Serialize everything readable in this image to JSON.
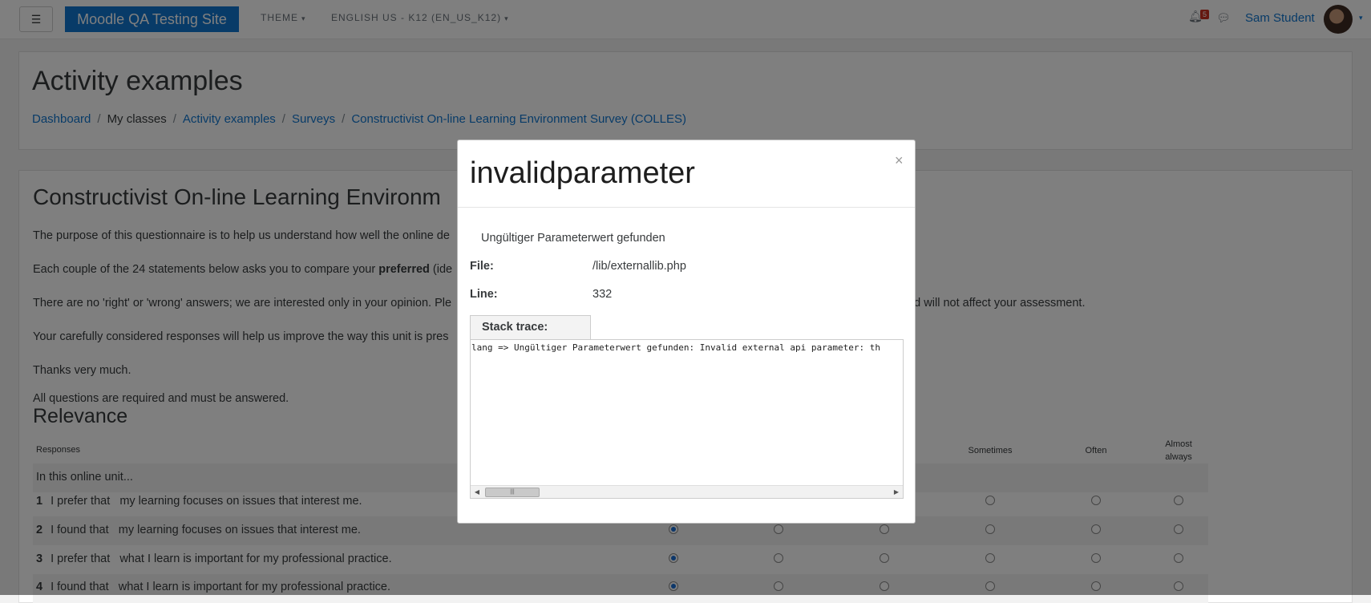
{
  "navbar": {
    "menu_icon": "☰",
    "site_name": "Moodle QA Testing Site",
    "theme_label": "THEME",
    "language_label": "ENGLISH US - K12 (EN_US_K12)",
    "notification_count": "5",
    "user_name": "Sam Student"
  },
  "page": {
    "heading": "Activity examples",
    "breadcrumb": [
      "Dashboard",
      "My classes",
      "Activity examples",
      "Surveys",
      "Constructivist On-line Learning Environment Survey (COLLES)"
    ]
  },
  "content": {
    "title": "Constructivist On-line Learning Environm",
    "paragraphs": [
      "The purpose of this questionnaire is to help us understand how well the online de",
      "Each couple of the 24 statements below asks you to compare your ",
      "There are no 'right' or 'wrong' answers; we are interested only in your opinion. Ple",
      ", and will not affect your assessment.",
      "Your carefully considered responses will help us improve the way this unit is pres",
      "Thanks very much.",
      "All questions are required and must be answered."
    ],
    "preferred_word": "preferred",
    "preferred_after": " (ide",
    "section_heading": "Relevance"
  },
  "table": {
    "responses_header": "Responses",
    "columns": [
      "Sometimes",
      "Often",
      "Almost always"
    ],
    "intro_row": "In this online unit...",
    "rows": [
      {
        "num": "1",
        "prefix": "I prefer that",
        "text": "my learning focuses on issues that interest me."
      },
      {
        "num": "2",
        "prefix": "I found that",
        "text": "my learning focuses on issues that interest me."
      },
      {
        "num": "3",
        "prefix": "I prefer that",
        "text": "what I learn is important for my professional practice."
      },
      {
        "num": "4",
        "prefix": "I found that",
        "text": "what I learn is important for my professional practice."
      }
    ]
  },
  "modal": {
    "title": "invalidparameter",
    "close_icon": "×",
    "message": "Ungültiger Parameterwert gefunden",
    "file_label": "File:",
    "file_value": "/lib/externallib.php",
    "line_label": "Line:",
    "line_value": "332",
    "stack_label": "Stack trace:",
    "stack_text": "lang => Ungültiger Parameterwert gefunden: Invalid external api parameter: th"
  }
}
